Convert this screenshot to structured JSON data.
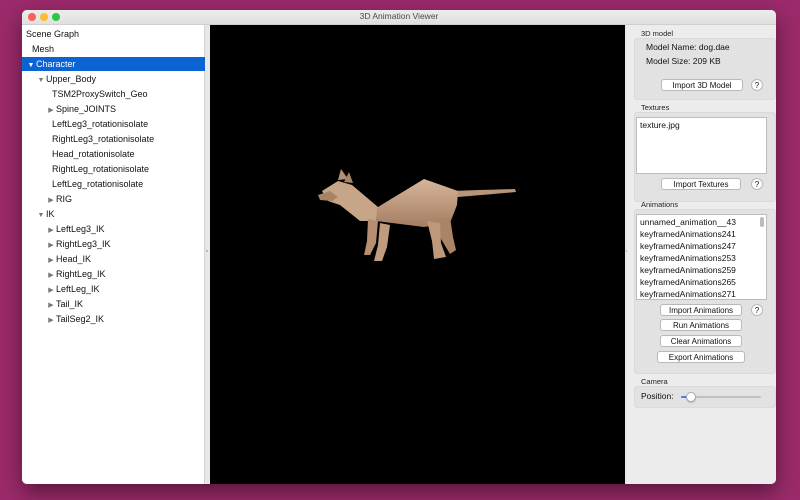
{
  "window": {
    "title": "3D Animation Viewer"
  },
  "scene_graph": {
    "nodes": [
      {
        "label": "Scene Graph",
        "arrow": ""
      },
      {
        "label": "Mesh",
        "arrow": ""
      },
      {
        "label": "Character",
        "arrow": "▼"
      },
      {
        "label": "Upper_Body",
        "arrow": "▼"
      },
      {
        "label": "TSM2ProxySwitch_Geo",
        "arrow": ""
      },
      {
        "label": "Spine_JOINTS",
        "arrow": "▶"
      },
      {
        "label": "LeftLeg3_rotationisolate",
        "arrow": ""
      },
      {
        "label": "RightLeg3_rotationisolate",
        "arrow": ""
      },
      {
        "label": "Head_rotationisolate",
        "arrow": ""
      },
      {
        "label": "RightLeg_rotationisolate",
        "arrow": ""
      },
      {
        "label": "LeftLeg_rotationisolate",
        "arrow": ""
      },
      {
        "label": "RIG",
        "arrow": "▶"
      },
      {
        "label": "IK",
        "arrow": "▼"
      },
      {
        "label": "LeftLeg3_IK",
        "arrow": "▶"
      },
      {
        "label": "RightLeg3_IK",
        "arrow": "▶"
      },
      {
        "label": "Head_IK",
        "arrow": "▶"
      },
      {
        "label": "RightLeg_IK",
        "arrow": "▶"
      },
      {
        "label": "LeftLeg_IK",
        "arrow": "▶"
      },
      {
        "label": "Tail_IK",
        "arrow": "▶"
      },
      {
        "label": "TailSeg2_IK",
        "arrow": "▶"
      }
    ],
    "selected_index": 2
  },
  "model": {
    "section_title": "3D model",
    "name_line": "Model Name: dog.dae",
    "size_line": "Model Size: 209 KB",
    "import_button": "Import 3D Model",
    "help": "?"
  },
  "textures": {
    "section_title": "Textures",
    "files": [
      "texture.jpg"
    ],
    "import_button": "Import Textures",
    "help": "?"
  },
  "animations": {
    "section_title": "Animations",
    "items": [
      "unnamed_animation__43",
      "keyframedAnimations241",
      "keyframedAnimations247",
      "keyframedAnimations253",
      "keyframedAnimations259",
      "keyframedAnimations265",
      "keyframedAnimations271"
    ],
    "import_button": "Import Animations",
    "run_button": "Run Animations",
    "clear_button": "Clear Animations",
    "export_button": "Export Animations",
    "help": "?"
  },
  "camera": {
    "section_title": "Camera",
    "position_label": "Position:",
    "position_value": 0.12
  },
  "colors": {
    "selection": "#0c63d4",
    "viewport_bg": "#000000",
    "dog_body": "#c19a7f",
    "desktop": "#9b2a6b",
    "slider_accent": "#3b82f6"
  }
}
